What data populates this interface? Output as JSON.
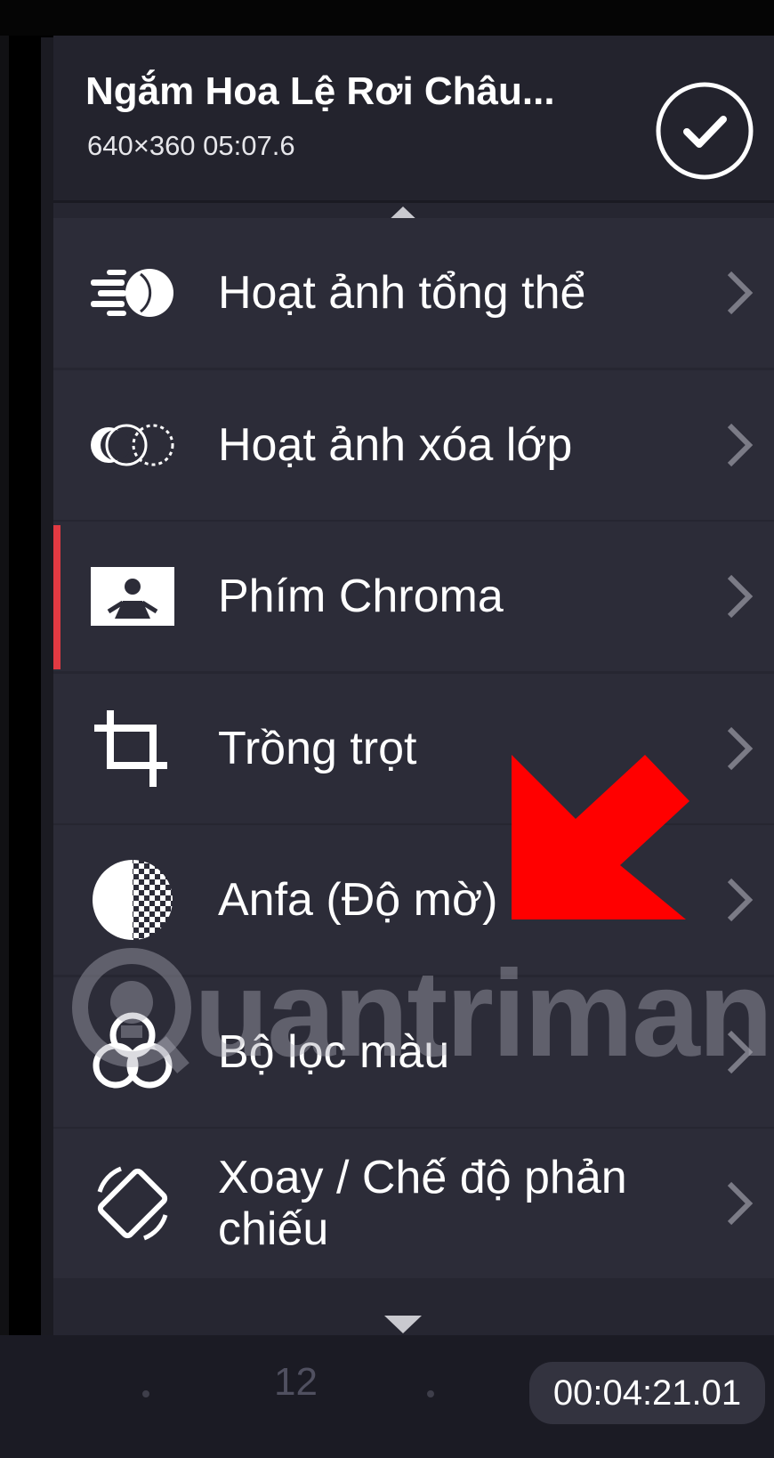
{
  "header": {
    "title": "Ngắm Hoa Lệ Rơi   Châu...",
    "subtitle": "640×360  05:07.6",
    "confirm_icon": "check-circle-icon"
  },
  "menu": {
    "items": [
      {
        "label": "Hoạt ảnh tổng thể",
        "icon": "animation-icon",
        "active": false
      },
      {
        "label": "Hoạt ảnh xóa lớp",
        "icon": "layer-wipe-icon",
        "active": false
      },
      {
        "label": "Phím Chroma",
        "icon": "chroma-key-icon",
        "active": true
      },
      {
        "label": "Trồng trọt",
        "icon": "crop-icon",
        "active": false
      },
      {
        "label": "Anfa (Độ mờ)",
        "icon": "opacity-icon",
        "active": false
      },
      {
        "label": "Bộ lọc màu",
        "icon": "color-filter-icon",
        "active": false
      },
      {
        "label": "Xoay / Chế độ phản chiếu",
        "icon": "rotate-mirror-icon",
        "active": false
      }
    ]
  },
  "watermark": {
    "text": "uantrimang"
  },
  "footer": {
    "frame_number": "12",
    "timecode": "00:04:21.01"
  },
  "colors": {
    "accent": "#e13a42",
    "arrow": "#ff0000"
  }
}
